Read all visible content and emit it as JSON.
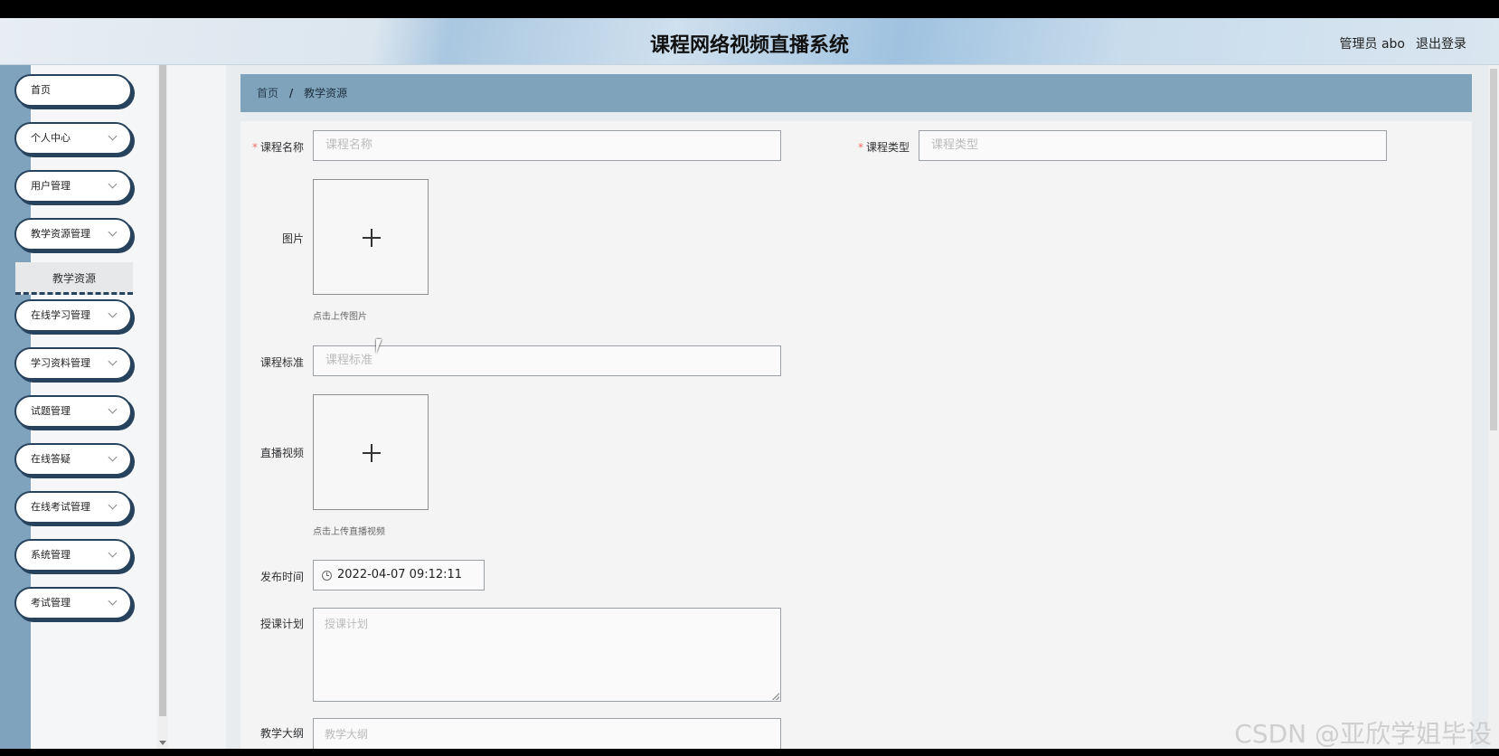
{
  "header": {
    "title": "课程网络视频直播系统",
    "user_label": "管理员 abo",
    "logout_label": "退出登录"
  },
  "sidebar": {
    "items": [
      {
        "label": "首页",
        "has_arrow": false
      },
      {
        "label": "个人中心",
        "has_arrow": true
      },
      {
        "label": "用户管理",
        "has_arrow": true
      },
      {
        "label": "教学资源管理",
        "has_arrow": true
      },
      {
        "label": "在线学习管理",
        "has_arrow": true
      },
      {
        "label": "学习资料管理",
        "has_arrow": true
      },
      {
        "label": "试题管理",
        "has_arrow": true
      },
      {
        "label": "在线答疑",
        "has_arrow": true
      },
      {
        "label": "在线考试管理",
        "has_arrow": true
      },
      {
        "label": "系统管理",
        "has_arrow": true
      },
      {
        "label": "考试管理",
        "has_arrow": true
      }
    ],
    "submenu_active": "教学资源"
  },
  "breadcrumb": {
    "home": "首页",
    "separator": "/",
    "current": "教学资源"
  },
  "form": {
    "course_name": {
      "label": "课程名称",
      "placeholder": "课程名称",
      "required": true
    },
    "course_type": {
      "label": "课程类型",
      "placeholder": "课程类型",
      "required": true
    },
    "image": {
      "label": "图片",
      "hint": "点击上传图片"
    },
    "course_standard": {
      "label": "课程标准",
      "placeholder": "课程标准"
    },
    "live_video": {
      "label": "直播视频",
      "hint": "点击上传直播视频"
    },
    "publish_time": {
      "label": "发布时间",
      "value": "2022-04-07 09:12:11"
    },
    "teaching_plan": {
      "label": "授课计划",
      "placeholder": "授课计划"
    },
    "syllabus": {
      "label": "教学大纲",
      "placeholder": "教学大纲"
    }
  },
  "watermark": "CSDN @亚欣学姐毕设",
  "colors": {
    "accent": "#7fa3ba",
    "menu_border": "#26425c",
    "required": "#f56c6c"
  }
}
